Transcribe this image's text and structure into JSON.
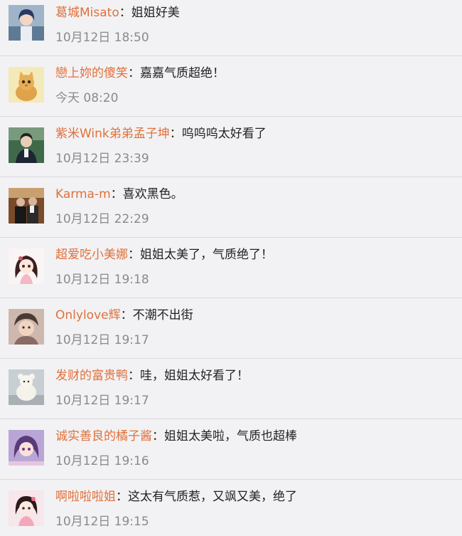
{
  "colors": {
    "background": "#f2f2f4",
    "username": "#e0703a",
    "text": "#222222",
    "timestamp": "#8a8a8e",
    "divider": "#d9d9de"
  },
  "comments": [
    {
      "username": "葛城Misato",
      "separator": "：",
      "text": "姐姐好美",
      "time": "10月12日 18:50",
      "avatar": "avatar-icon-anime-girl"
    },
    {
      "username": "戀上妳的傻笑",
      "separator": "：",
      "text": "嘉嘉气质超绝！",
      "time": "今天 08:20",
      "avatar": "avatar-icon-kitten"
    },
    {
      "username": "紫米Wink弟弟孟子坤",
      "separator": "：",
      "text": "呜呜呜太好看了",
      "time": "10月12日 23:39",
      "avatar": "avatar-icon-person-outdoor"
    },
    {
      "username": "Karma-m",
      "separator": "：",
      "text": "喜欢黑色。",
      "time": "10月12日 22:29",
      "avatar": "avatar-icon-group-photo"
    },
    {
      "username": "超爱吃小美娜",
      "separator": "：",
      "text": "姐姐太美了，气质绝了！",
      "time": "10月12日 19:18",
      "avatar": "avatar-icon-cartoon-girl"
    },
    {
      "username": "Onlylove辉",
      "separator": "：",
      "text": "不潮不出街",
      "time": "10月12日 19:17",
      "avatar": "avatar-icon-child"
    },
    {
      "username": "发财的富贵鸭",
      "separator": "：",
      "text": "哇，姐姐太好看了！",
      "time": "10月12日 19:17",
      "avatar": "avatar-icon-white-toy"
    },
    {
      "username": "诚实善良的橘子酱",
      "separator": "：",
      "text": "姐姐太美啦，气质也超棒",
      "time": "10月12日 19:16",
      "avatar": "avatar-icon-anime-purple"
    },
    {
      "username": "啊啦啦啦姐",
      "separator": "：",
      "text": "这太有气质惹，又飒又美，绝了",
      "time": "10月12日 19:15",
      "avatar": "avatar-icon-cartoon-pink"
    }
  ]
}
